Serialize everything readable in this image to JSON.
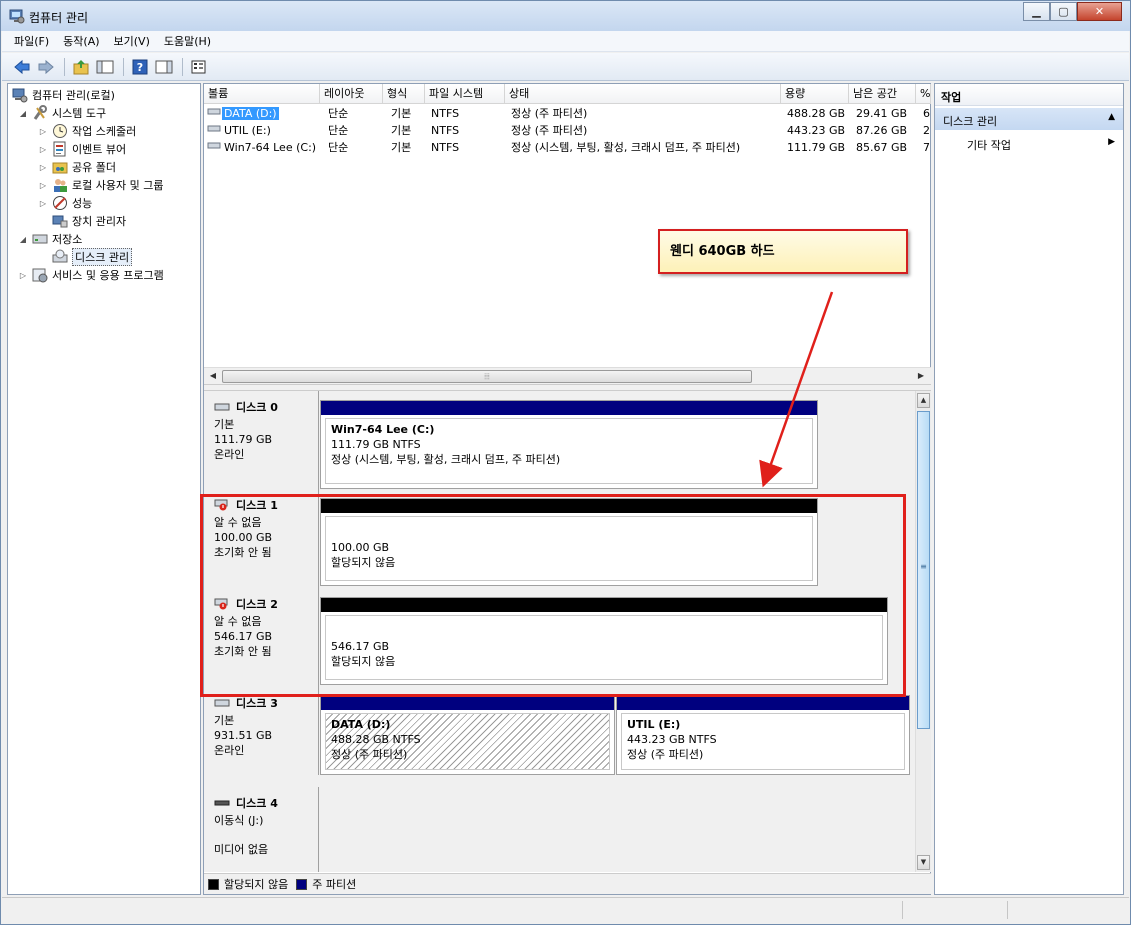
{
  "window": {
    "title": "컴퓨터 관리",
    "buttons": {
      "minimize": "▁",
      "maximize": "▢",
      "close": "✕"
    }
  },
  "menu": [
    "파일(F)",
    "동작(A)",
    "보기(V)",
    "도움말(H)"
  ],
  "toolbar": [
    "back-icon",
    "forward-icon",
    "up-folder-icon",
    "show-hide-tree-icon",
    "help-icon",
    "show-hide-action-icon",
    "properties-icon"
  ],
  "tree": {
    "root": "컴퓨터 관리(로컬)",
    "system_tools": "시스템 도구",
    "task_scheduler": "작업 스케줄러",
    "event_viewer": "이벤트 뷰어",
    "shared_folders": "공유 폴더",
    "local_users": "로컬 사용자 및 그룹",
    "performance": "성능",
    "device_manager": "장치 관리자",
    "storage": "저장소",
    "disk_management": "디스크 관리",
    "services": "서비스 및 응용 프로그램"
  },
  "volume_list": {
    "columns": [
      "볼륨",
      "레이아웃",
      "형식",
      "파일 시스템",
      "상태",
      "용량",
      "남은 공간",
      "%"
    ],
    "rows": [
      {
        "name": "DATA (D:)",
        "layout": "단순",
        "type": "기본",
        "fs": "NTFS",
        "status": "정상 (주 파티션)",
        "capacity": "488.28 GB",
        "free": "29.41 GB",
        "pct": "6"
      },
      {
        "name": "UTIL (E:)",
        "layout": "단순",
        "type": "기본",
        "fs": "NTFS",
        "status": "정상 (주 파티션)",
        "capacity": "443.23 GB",
        "free": "87.26 GB",
        "pct": "2"
      },
      {
        "name": "Win7-64 Lee (C:)",
        "layout": "단순",
        "type": "기본",
        "fs": "NTFS",
        "status": "정상 (시스템, 부팅, 활성, 크래시 덤프, 주 파티션)",
        "capacity": "111.79 GB",
        "free": "85.67 GB",
        "pct": "7"
      }
    ]
  },
  "disks": [
    {
      "name": "디스크 0",
      "type": "기본",
      "size": "111.79 GB",
      "state": "온라인",
      "partitions": [
        {
          "label": "Win7-64 Lee  (C:)",
          "size": "111.79 GB NTFS",
          "status": "정상 (시스템, 부팅, 활성, 크래시 덤프, 주 파티션)"
        }
      ]
    },
    {
      "name": "디스크 1",
      "type": "알 수 없음",
      "size": "100.00 GB",
      "state": "초기화 안 됨",
      "partitions": [
        {
          "size": "100.00 GB",
          "status": "할당되지 않음"
        }
      ]
    },
    {
      "name": "디스크 2",
      "type": "알 수 없음",
      "size": "546.17 GB",
      "state": "초기화 안 됨",
      "partitions": [
        {
          "size": "546.17 GB",
          "status": "할당되지 않음"
        }
      ]
    },
    {
      "name": "디스크 3",
      "type": "기본",
      "size": "931.51 GB",
      "state": "온라인",
      "partitions": [
        {
          "label": "DATA  (D:)",
          "size": "488.28 GB NTFS",
          "status": "정상 (주 파티션)"
        },
        {
          "label": "UTIL  (E:)",
          "size": "443.23 GB NTFS",
          "status": "정상 (주 파티션)"
        }
      ]
    },
    {
      "name": "디스크 4",
      "type": "이동식 (J:)",
      "state": "미디어 없음"
    }
  ],
  "legend": {
    "unallocated": "할당되지 않음",
    "primary": "주 파티션"
  },
  "callout": "웬디 640GB 하드",
  "actions": {
    "title": "작업",
    "section": "디스크 관리",
    "item": "기타 작업"
  },
  "colors": {
    "primary_partition": "#00007f",
    "unallocated": "#000000",
    "annotation": "#e0201b"
  }
}
